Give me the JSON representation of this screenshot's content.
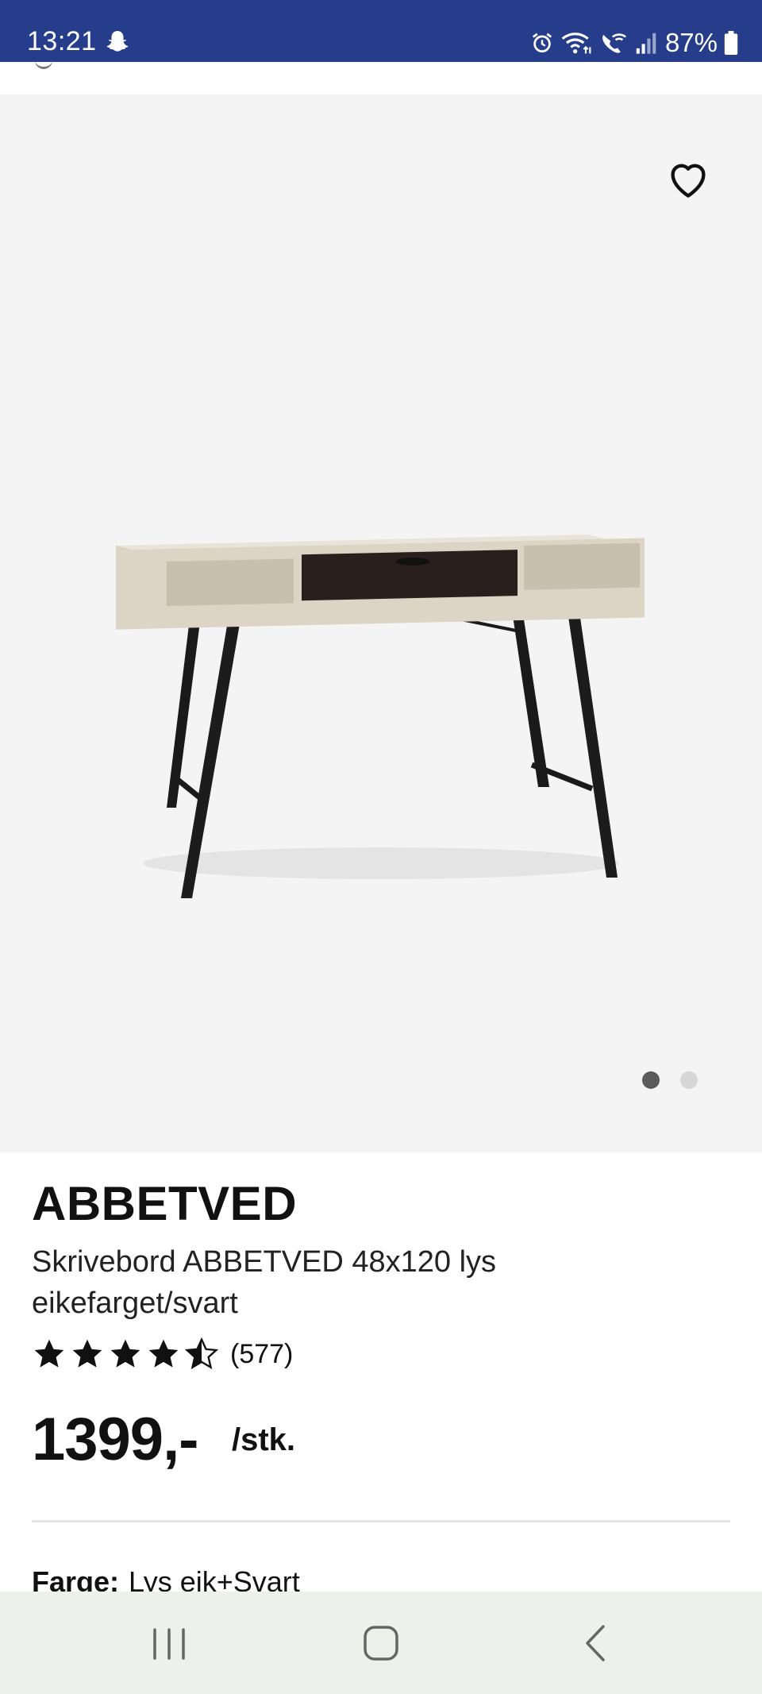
{
  "status_bar": {
    "time": "13:21",
    "battery_percent": "87%",
    "icons": [
      "snapchat-icon",
      "alarm-icon",
      "wifi-icon",
      "wifi-calling-icon",
      "signal-icon",
      "battery-icon"
    ]
  },
  "gallery": {
    "image": "desk-image",
    "favorite_icon": "heart-outline-icon",
    "page_count": 2,
    "active_page": 1
  },
  "product": {
    "brand": "ABBETVED",
    "title": "Skrivebord ABBETVED 48x120 lys eikefarget/svart",
    "rating": 4.5,
    "review_count": "(577)",
    "price": "1399,-",
    "unit": "/stk.",
    "color_label": "Farge:",
    "color_value": "Lys eik+Svart"
  },
  "colors": {
    "status_bar_bg": "#263d8c",
    "gallery_bg": "#f4f4f4",
    "nav_bar_bg": "#eef0ec"
  }
}
